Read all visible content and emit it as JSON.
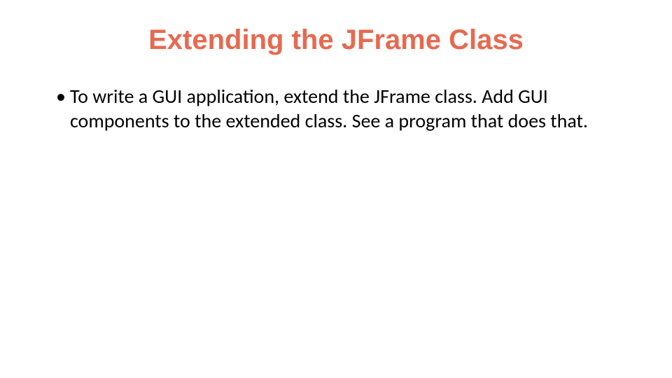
{
  "slide": {
    "title": "Extending the JFrame Class",
    "bullets": [
      {
        "text": "To write a GUI application, extend the JFrame class. Add GUI components to the extended class. See a program that does that."
      }
    ],
    "colors": {
      "title": "#e66a50",
      "body": "#000000",
      "background": "#ffffff"
    }
  }
}
